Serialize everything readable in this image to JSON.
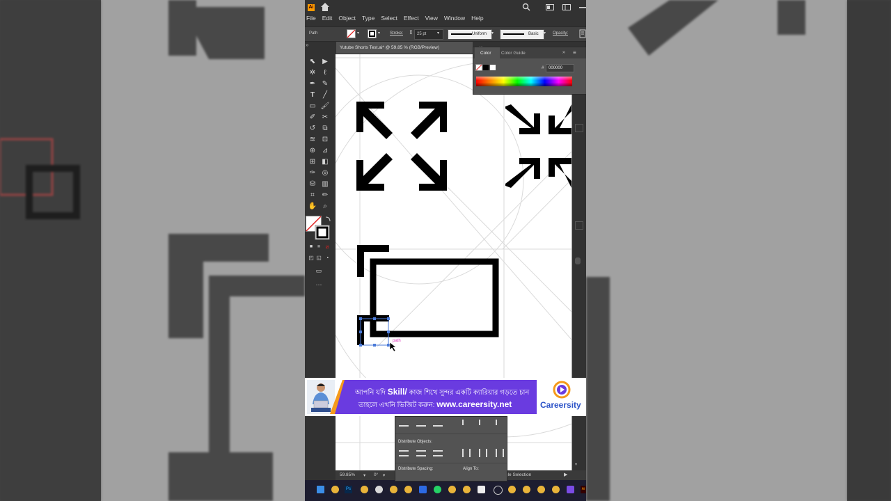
{
  "app": {
    "logo_text": "Ai"
  },
  "menu": [
    "File",
    "Edit",
    "Object",
    "Type",
    "Select",
    "Effect",
    "View",
    "Window",
    "Help"
  ],
  "control_bar": {
    "selection_type": "Path",
    "stroke_label": "Stroke:",
    "stroke_weight": "25 pt",
    "profile": "Uniform",
    "brush": "Basic",
    "opacity_label": "Opacity:"
  },
  "document_tab": {
    "title": "Yutube Shorts Test.ai* @ 59.85 % (RGB/Preview)",
    "close": "×"
  },
  "color_panel": {
    "tab_color": "Color",
    "tab_guide": "Color Guide",
    "hash": "#",
    "hex_value": "000000"
  },
  "canvas": {
    "smart_guide_label": "path"
  },
  "status_bar": {
    "zoom": "59.85%",
    "rotation": "0°",
    "tool_status": "gle Selection"
  },
  "banner": {
    "line1_prefix": "আপনি যদি ",
    "line1_skill": "Skill/",
    "line1_suffix": " কাজ শিখে সুন্দর একটি ক্যারিয়ার গড়তে চান",
    "line2_prefix": "তাহলে এখনি ভিজিট করুন: ",
    "line2_url": "www.careersity.net",
    "brand": "Careersity"
  },
  "align_panel": {
    "distribute_objects": "Distribute Objects:",
    "distribute_spacing": "Distribute Spacing:",
    "align_to": "Align To:"
  },
  "taskbar": {
    "ps_label": "Ps",
    "ai_label": "Ai"
  },
  "colors": {
    "accent": "#ff9a00",
    "banner_purple": "#6a3be0",
    "banner_orange": "#f59a1b",
    "brand_blue": "#2c53c8",
    "selection_blue": "#4a7ad8"
  }
}
